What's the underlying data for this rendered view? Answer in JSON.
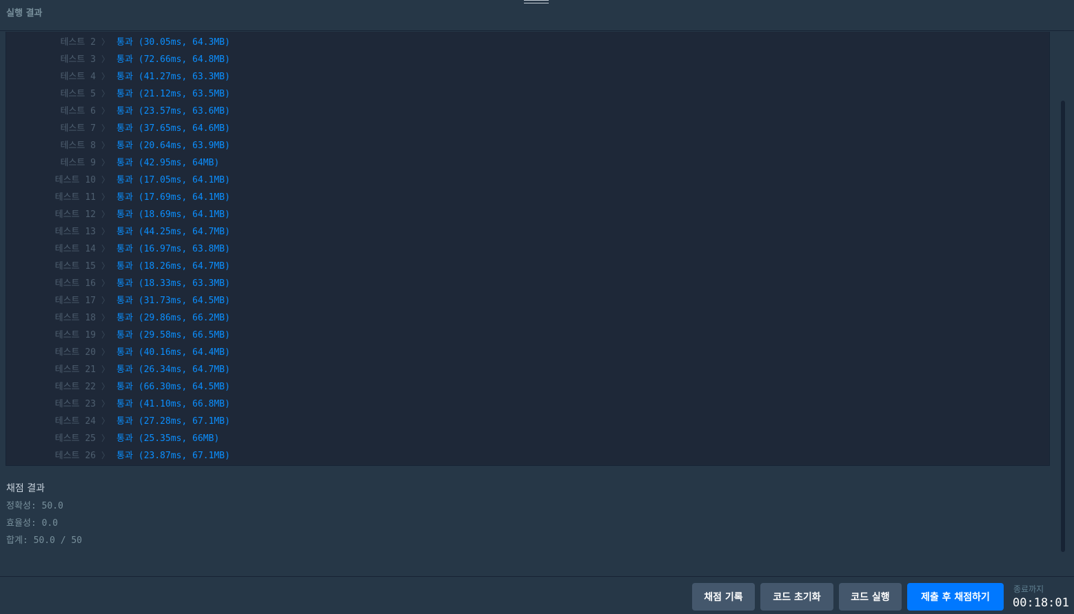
{
  "header": {
    "title": "실행 결과"
  },
  "tests": [
    {
      "label": "테스트 2",
      "result": "통과 (30.05ms, 64.3MB)"
    },
    {
      "label": "테스트 3",
      "result": "통과 (72.66ms, 64.8MB)"
    },
    {
      "label": "테스트 4",
      "result": "통과 (41.27ms, 63.3MB)"
    },
    {
      "label": "테스트 5",
      "result": "통과 (21.12ms, 63.5MB)"
    },
    {
      "label": "테스트 6",
      "result": "통과 (23.57ms, 63.6MB)"
    },
    {
      "label": "테스트 7",
      "result": "통과 (37.65ms, 64.6MB)"
    },
    {
      "label": "테스트 8",
      "result": "통과 (20.64ms, 63.9MB)"
    },
    {
      "label": "테스트 9",
      "result": "통과 (42.95ms, 64MB)"
    },
    {
      "label": "테스트 10",
      "result": "통과 (17.05ms, 64.1MB)"
    },
    {
      "label": "테스트 11",
      "result": "통과 (17.69ms, 64.1MB)"
    },
    {
      "label": "테스트 12",
      "result": "통과 (18.69ms, 64.1MB)"
    },
    {
      "label": "테스트 13",
      "result": "통과 (44.25ms, 64.7MB)"
    },
    {
      "label": "테스트 14",
      "result": "통과 (16.97ms, 63.8MB)"
    },
    {
      "label": "테스트 15",
      "result": "통과 (18.26ms, 64.7MB)"
    },
    {
      "label": "테스트 16",
      "result": "통과 (18.33ms, 63.3MB)"
    },
    {
      "label": "테스트 17",
      "result": "통과 (31.73ms, 64.5MB)"
    },
    {
      "label": "테스트 18",
      "result": "통과 (29.86ms, 66.2MB)"
    },
    {
      "label": "테스트 19",
      "result": "통과 (29.58ms, 66.5MB)"
    },
    {
      "label": "테스트 20",
      "result": "통과 (40.16ms, 64.4MB)"
    },
    {
      "label": "테스트 21",
      "result": "통과 (26.34ms, 64.7MB)"
    },
    {
      "label": "테스트 22",
      "result": "통과 (66.30ms, 64.5MB)"
    },
    {
      "label": "테스트 23",
      "result": "통과 (41.10ms, 66.8MB)"
    },
    {
      "label": "테스트 24",
      "result": "통과 (27.28ms, 67.1MB)"
    },
    {
      "label": "테스트 25",
      "result": "통과 (25.35ms, 66MB)"
    },
    {
      "label": "테스트 26",
      "result": "통과 (23.87ms, 67.1MB)"
    }
  ],
  "separator": "〉",
  "grading": {
    "title": "채점 결과",
    "accuracy": "정확성: 50.0",
    "efficiency": "효율성: 0.0",
    "total": "합계: 50.0 / 50"
  },
  "footer": {
    "history_label": "채점 기록",
    "reset_label": "코드 초기화",
    "run_label": "코드 실행",
    "submit_label": "제출 후 채점하기",
    "timer_label": "종료까지",
    "timer_value": "00:18:01"
  },
  "colors": {
    "background": "#263747",
    "panel": "#1e2838",
    "pass": "#0b8fff",
    "primary_button": "#0078ff",
    "secondary_button": "#44576c"
  }
}
